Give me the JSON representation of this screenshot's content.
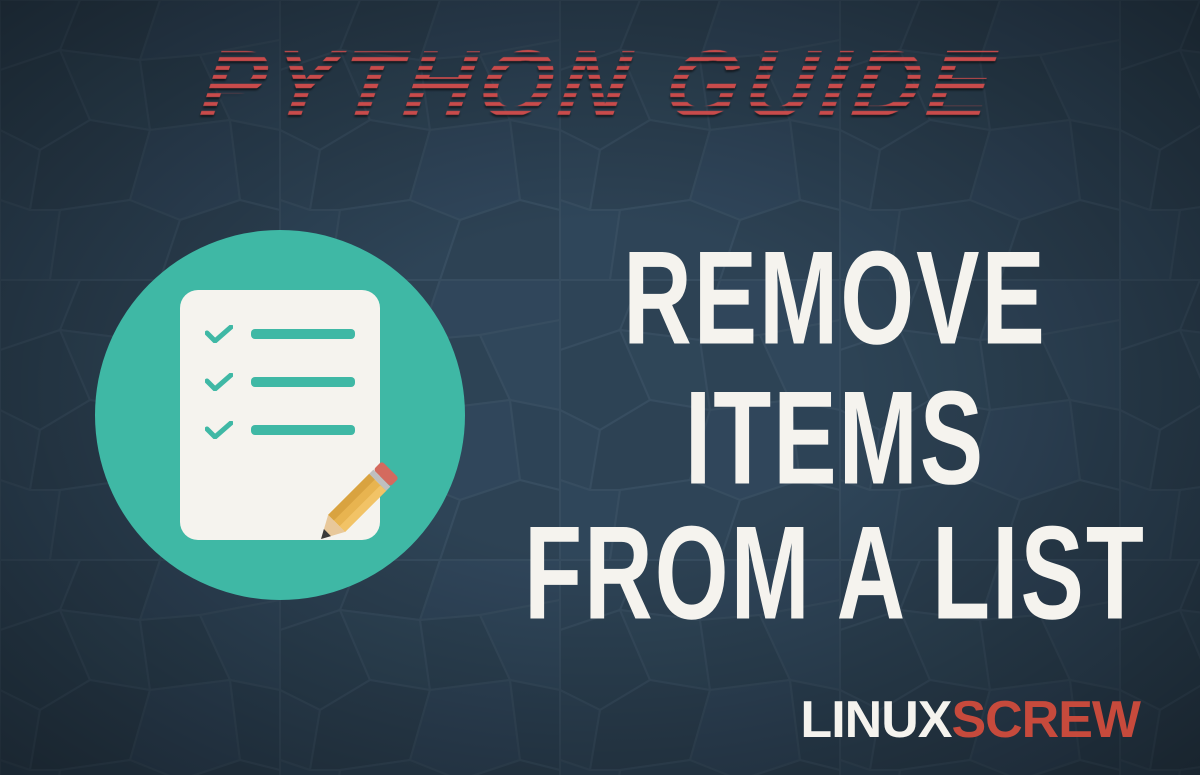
{
  "header": {
    "title": "PYTHON GUIDE"
  },
  "main": {
    "line1": "REMOVE ITEMS",
    "line2": "FROM A LIST"
  },
  "logo": {
    "part1": "LINUX",
    "part2": "SCREW"
  },
  "colors": {
    "background": "#2d4254",
    "accent_circle": "#3fb8a5",
    "header_text": "#c94b4b",
    "main_text": "#f5f3ee",
    "logo_accent": "#c74a3c"
  },
  "icon": {
    "name": "checklist-with-pencil",
    "check_rows": 3
  }
}
